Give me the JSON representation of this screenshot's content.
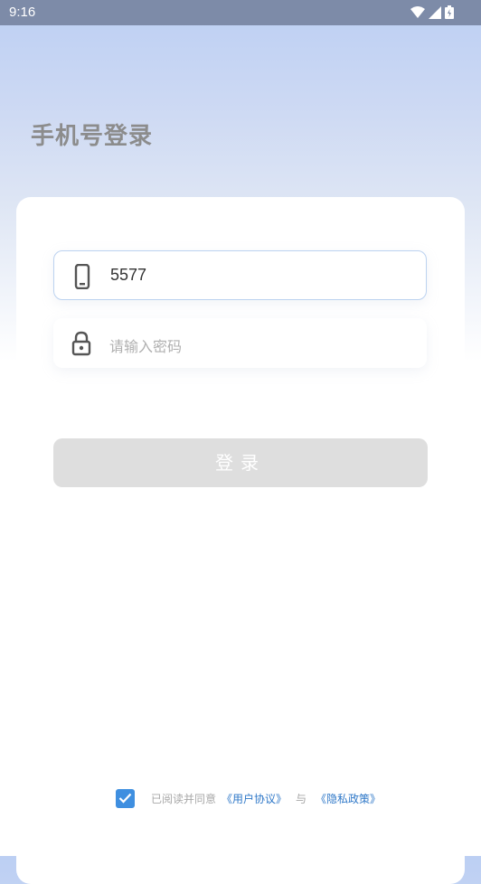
{
  "status_bar": {
    "time": "9:16",
    "icons": [
      "wifi-icon",
      "signal-icon",
      "battery-icon"
    ]
  },
  "page": {
    "title": "手机号登录"
  },
  "phone_field": {
    "value": "5577",
    "icon": "phone-icon"
  },
  "password_field": {
    "placeholder": "请输入密码",
    "icon": "lock-icon"
  },
  "login_button": {
    "label": "登录"
  },
  "agreement": {
    "checked": true,
    "prefix": "已阅读并同意",
    "user_agreement": "《用户协议》",
    "and": "与",
    "privacy_policy": "《隐私政策》"
  },
  "colors": {
    "accent": "#3f8fe0",
    "link": "#2f78c8",
    "button_disabled": "#dedede"
  }
}
